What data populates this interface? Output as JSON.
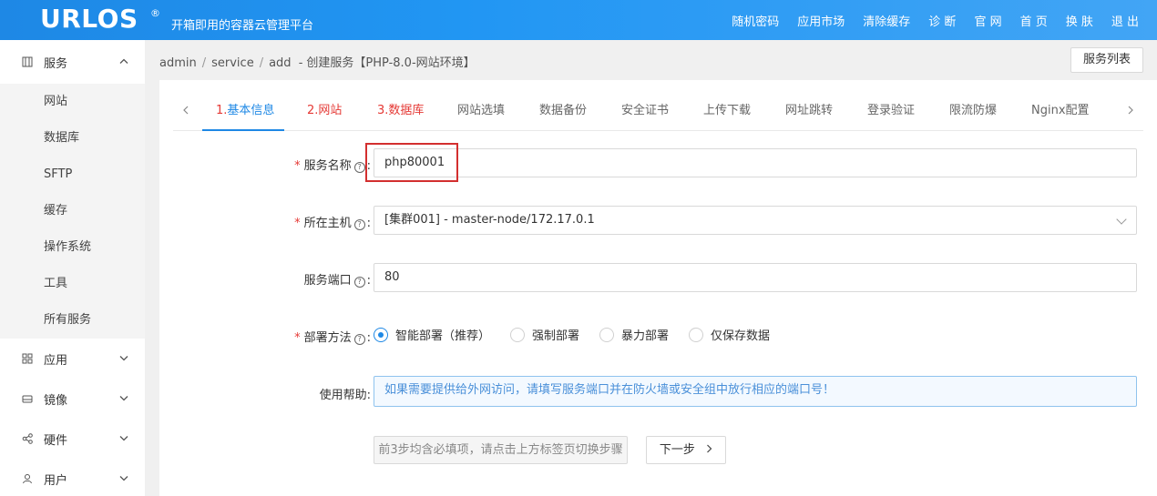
{
  "header": {
    "logo": "URLOS",
    "logo_mark": "®",
    "slogan": "开箱即用的容器云管理平台",
    "nav": [
      "随机密码",
      "应用市场",
      "清除缓存",
      "诊 断",
      "官 网",
      "首 页",
      "换 肤",
      "退 出"
    ]
  },
  "sidebar": {
    "service_group": {
      "label": "服务",
      "icon": "grid-icon",
      "expanded": true
    },
    "service_items": [
      "网站",
      "数据库",
      "SFTP",
      "缓存",
      "操作系统",
      "工具",
      "所有服务"
    ],
    "groups": [
      {
        "label": "应用",
        "icon": "apps-icon"
      },
      {
        "label": "镜像",
        "icon": "disk-icon"
      },
      {
        "label": "硬件",
        "icon": "share-icon"
      },
      {
        "label": "用户",
        "icon": "user-icon"
      }
    ]
  },
  "breadcrumb": {
    "parts": [
      "admin",
      "service",
      "add"
    ],
    "dash": "-",
    "title": "创建服务【PHP-8.0-网站环境】"
  },
  "service_list_button": "服务列表",
  "tabs": {
    "items": [
      {
        "num": "1.",
        "label": "基本信息"
      },
      {
        "num": "2.",
        "label": "网站"
      },
      {
        "num": "3.",
        "label": "数据库"
      },
      {
        "label": "网站选填"
      },
      {
        "label": "数据备份"
      },
      {
        "label": "安全证书"
      },
      {
        "label": "上传下载"
      },
      {
        "label": "网址跳转"
      },
      {
        "label": "登录验证"
      },
      {
        "label": "限流防爆"
      },
      {
        "label": "Nginx配置"
      }
    ]
  },
  "form": {
    "service_name": {
      "label": "服务名称",
      "value": "php80001"
    },
    "host": {
      "label": "所在主机",
      "value": "[集群001] - master-node/172.17.0.1"
    },
    "port": {
      "label": "服务端口",
      "value": "80"
    },
    "deploy": {
      "label": "部署方法",
      "options": [
        "智能部署（推荐）",
        "强制部署",
        "暴力部署",
        "仅保存数据"
      ],
      "selected_index": 0
    },
    "help": {
      "label": "使用帮助:",
      "text": "如果需要提供给外网访问，请填写服务端口并在防火墙或安全组中放行相应的端口号！"
    },
    "hint_button": "前3步均含必填项，请点击上方标签页切换步骤",
    "next_button": "下一步"
  },
  "colors": {
    "accent": "#1e88e5",
    "required": "#e53935",
    "highlight": "#d32f2f"
  }
}
